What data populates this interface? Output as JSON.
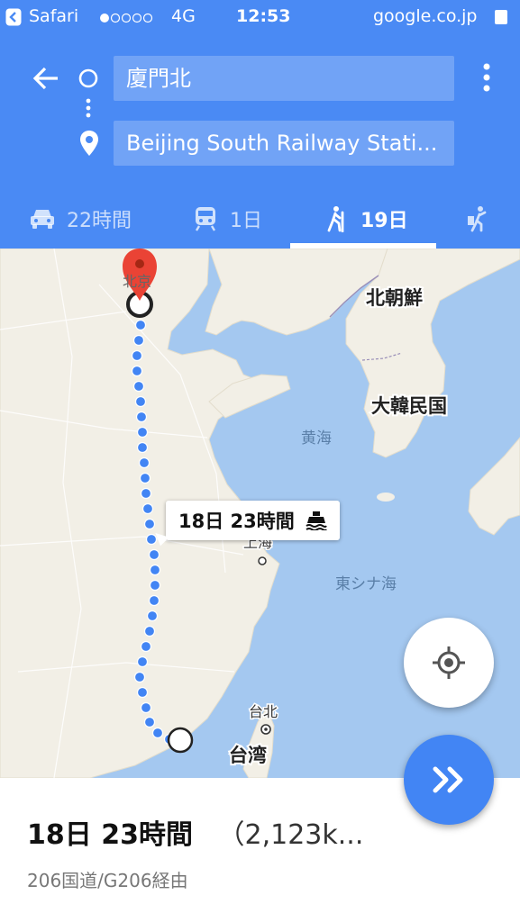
{
  "status_bar": {
    "back_app": "Safari",
    "network": "4G",
    "time": "12:53",
    "url": "google.co.jp"
  },
  "directions": {
    "origin": "廈門北",
    "destination": "Beijing South Railway Stati..."
  },
  "tabs": [
    {
      "mode": "drive",
      "icon": "car-icon",
      "label": "22時間",
      "active": false
    },
    {
      "mode": "transit",
      "icon": "train-icon",
      "label": "1日",
      "active": false
    },
    {
      "mode": "walk",
      "icon": "hiking-icon",
      "label": "19日",
      "active": true
    },
    {
      "mode": "ride",
      "icon": "rider-icon",
      "label": "",
      "active": false
    }
  ],
  "map": {
    "labels": {
      "beijing": "北京",
      "north_korea": "北朝鮮",
      "south_korea": "大韓民国",
      "yellow_sea": "黄海",
      "shanghai": "上海",
      "east_china_sea": "東シナ海",
      "taipei": "台北",
      "taiwan": "台湾"
    },
    "route_callout": "18日 23時間"
  },
  "summary": {
    "duration": "18日 23時間",
    "distance": "（2,123k...",
    "via": "206国道/G206経由"
  },
  "colors": {
    "header": "#4a8af4",
    "route_dot": "#4285f4",
    "pin": "#ea4335",
    "sea": "#a4c8f0",
    "land": "#f2efe6"
  }
}
